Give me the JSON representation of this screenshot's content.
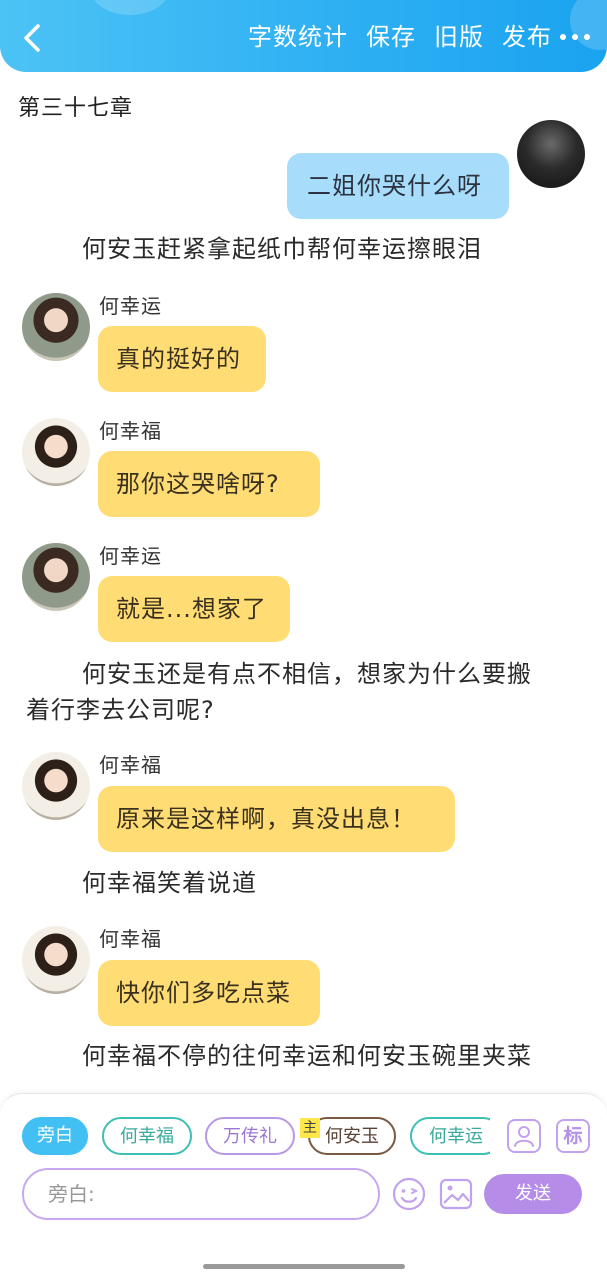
{
  "header": {
    "actions": [
      "字数统计",
      "保存",
      "旧版",
      "发布"
    ],
    "colors": {
      "header_start": "#4cc3f5",
      "header_end": "#1aa3f0"
    }
  },
  "chapter_title": "第三十七章",
  "chat": {
    "msg1": {
      "side": "right",
      "text": "二姐你哭什么呀"
    },
    "narr1": "何安玉赶紧拿起纸巾帮何幸运擦眼泪",
    "msg2": {
      "name": "何幸运",
      "text": "真的挺好的"
    },
    "msg3": {
      "name": "何幸福",
      "text": "那你这哭啥呀?"
    },
    "msg4": {
      "name": "何幸运",
      "text": "就是...想家了"
    },
    "narr2_line1": "何安玉还是有点不相信，想家为什么要搬",
    "narr2_line2": "着行李去公司呢?",
    "msg5": {
      "name": "何幸福",
      "text": "原来是这样啊，真没出息！"
    },
    "narr3": "何幸福笑着说道",
    "msg6": {
      "name": "何幸福",
      "text": "快你们多吃点菜"
    },
    "narr4": "何幸福不停的往何幸运和何安玉碗里夹菜"
  },
  "composer": {
    "chips": [
      "旁白",
      "何幸福",
      "万传礼",
      "何安玉",
      "何幸运"
    ],
    "active_chip": "旁白",
    "main_badge": "主",
    "tag_icon_label": "标",
    "input_placeholder": "旁白:",
    "send_label": "发送",
    "colors": {
      "accent_blue": "#43c0f3",
      "accent_purple": "#b58de8",
      "bubble_yellow": "#ffdd74",
      "bubble_blue": "#a8dcfb"
    }
  }
}
